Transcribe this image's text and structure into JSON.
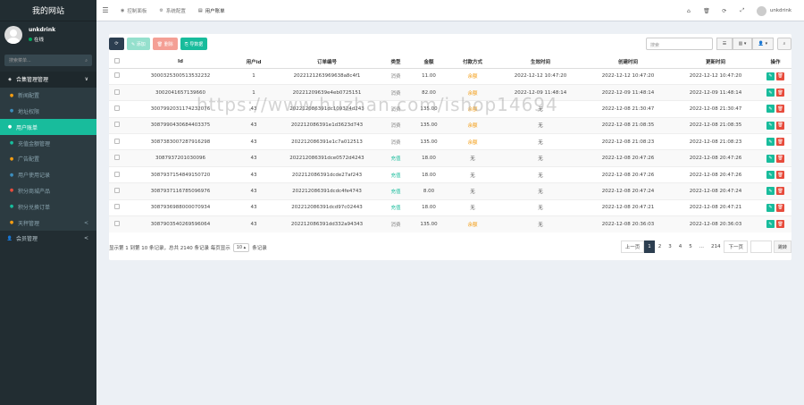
{
  "brand": "我的网站",
  "user": {
    "name": "unkdrink",
    "status": "在线"
  },
  "sidebar_search_placeholder": "搜索菜单...",
  "menu": [
    {
      "label": "合集管理管理",
      "icon": "cube-icon",
      "type": "open",
      "arrow": "∨"
    },
    {
      "label": "新闻配置",
      "icon": "circle-icon",
      "type": "sub",
      "arrow": ""
    },
    {
      "label": "地址权限",
      "icon": "circle-icon",
      "type": "sub",
      "arrow": ""
    },
    {
      "label": "用户账单",
      "icon": "circle-icon",
      "type": "active",
      "arrow": ""
    },
    {
      "label": "充值金额管理",
      "icon": "circle-icon",
      "type": "sub",
      "arrow": ""
    },
    {
      "label": "广告配置",
      "icon": "circle-icon",
      "type": "sub",
      "arrow": ""
    },
    {
      "label": "用户使用记录",
      "icon": "circle-icon",
      "type": "sub",
      "arrow": ""
    },
    {
      "label": "积分商城产品",
      "icon": "circle-icon",
      "type": "sub",
      "arrow": ""
    },
    {
      "label": "积分兑换订单",
      "icon": "circle-icon",
      "type": "sub",
      "arrow": ""
    },
    {
      "label": "天秤管理",
      "icon": "circle-icon",
      "type": "sub",
      "arrow": "<"
    },
    {
      "label": "会员管理",
      "icon": "user-icon",
      "type": "top",
      "arrow": "<"
    }
  ],
  "top_tabs": [
    {
      "label": "控制面板",
      "icon": "dashboard-icon"
    },
    {
      "label": "系统配置",
      "icon": "gear-icon"
    },
    {
      "label": "用户账单",
      "icon": "list-icon"
    }
  ],
  "top_user": "unkdrink",
  "toolbar": {
    "refresh": "⟳",
    "add": "✎ 添加",
    "delete": "🗑 删除",
    "export": "⎘ 导数据"
  },
  "search_placeholder": "搜索",
  "columns": [
    "",
    "Id",
    "用户id",
    "订单编号",
    "类型",
    "金额",
    "付款方式",
    "生效时间",
    "创建时间",
    "更新时间",
    "操作"
  ],
  "rows": [
    {
      "id": "3000325300513532232",
      "uid": "1",
      "order": "2022121263969638a8c4f1",
      "type": "消费",
      "type_style": "gray",
      "amount": "11.00",
      "pay": "余额",
      "pay_style": "orange",
      "effective": "2022-12-12 10:47:20",
      "created": "2022-12-12 10:47:20",
      "updated": "2022-12-12 10:47:20"
    },
    {
      "id": "3002041657139660",
      "uid": "1",
      "order": "20221209639e4eb0725151",
      "type": "消费",
      "type_style": "gray",
      "amount": "82.00",
      "pay": "余额",
      "pay_style": "orange",
      "effective": "2022-12-09 11:48:14",
      "created": "2022-12-09 11:48:14",
      "updated": "2022-12-09 11:48:14"
    },
    {
      "id": "3007992031174232076",
      "uid": "43",
      "order": "202212086391dc109324d243",
      "type": "消费",
      "type_style": "gray",
      "amount": "135.00",
      "pay": "余额",
      "pay_style": "orange",
      "effective": "无",
      "created": "2022-12-08 21:30:47",
      "updated": "2022-12-08 21:30:47"
    },
    {
      "id": "3087990430684403375",
      "uid": "43",
      "order": "202212086391e1d3623d743",
      "type": "消费",
      "type_style": "gray",
      "amount": "135.00",
      "pay": "余额",
      "pay_style": "orange",
      "effective": "无",
      "created": "2022-12-08 21:08:35",
      "updated": "2022-12-08 21:08:35"
    },
    {
      "id": "3087383007287916298",
      "uid": "43",
      "order": "202212086391e1c7a012513",
      "type": "消费",
      "type_style": "gray",
      "amount": "135.00",
      "pay": "余额",
      "pay_style": "orange",
      "effective": "无",
      "created": "2022-12-08 21:08:23",
      "updated": "2022-12-08 21:08:23"
    },
    {
      "id": "3087937201030096",
      "uid": "43",
      "order": "202212086391dce0572d4243",
      "type": "充值",
      "type_style": "green",
      "amount": "18.00",
      "pay": "无",
      "pay_style": "plain",
      "effective": "无",
      "created": "2022-12-08 20:47:26",
      "updated": "2022-12-08 20:47:26"
    },
    {
      "id": "3087937154849150720",
      "uid": "43",
      "order": "202212086391dcde27af243",
      "type": "充值",
      "type_style": "green",
      "amount": "18.00",
      "pay": "无",
      "pay_style": "plain",
      "effective": "无",
      "created": "2022-12-08 20:47:26",
      "updated": "2022-12-08 20:47:26"
    },
    {
      "id": "3087937116785096976",
      "uid": "43",
      "order": "202212086391dcdc4fe4743",
      "type": "充值",
      "type_style": "green",
      "amount": "8.00",
      "pay": "无",
      "pay_style": "plain",
      "effective": "无",
      "created": "2022-12-08 20:47:24",
      "updated": "2022-12-08 20:47:24"
    },
    {
      "id": "3087936988000070934",
      "uid": "43",
      "order": "202212086391dcd97c02443",
      "type": "充值",
      "type_style": "green",
      "amount": "18.00",
      "pay": "无",
      "pay_style": "plain",
      "effective": "无",
      "created": "2022-12-08 20:47:21",
      "updated": "2022-12-08 20:47:21"
    },
    {
      "id": "3087903540269596064",
      "uid": "43",
      "order": "202212086391dd332a94343",
      "type": "消费",
      "type_style": "gray",
      "amount": "135.00",
      "pay": "余额",
      "pay_style": "orange",
      "effective": "无",
      "created": "2022-12-08 20:36:03",
      "updated": "2022-12-08 20:36:03"
    }
  ],
  "pagination": {
    "info_prefix": "显示第 1 到第 10 条记录，总共 2140 条记录 每页显示",
    "page_size": "10 ▴",
    "info_suffix": "条记录",
    "prev": "上一页",
    "pages": [
      "1",
      "2",
      "3",
      "4",
      "5",
      "...",
      "214"
    ],
    "next": "下一页",
    "jump": "跳转"
  },
  "watermark": "https://www.huzhan.com/ishop14694"
}
